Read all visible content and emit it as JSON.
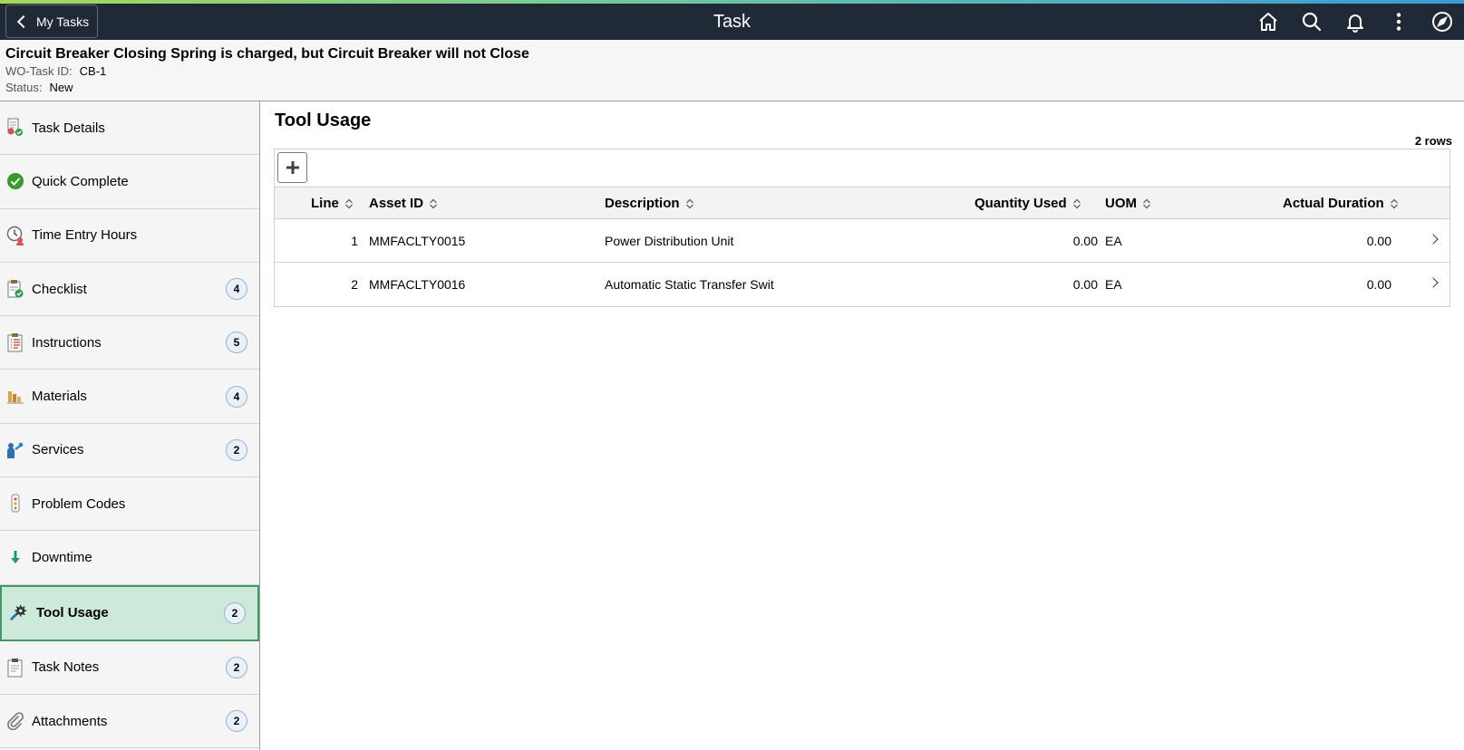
{
  "header": {
    "back_label": "My Tasks",
    "title": "Task",
    "icons": [
      "home-icon",
      "search-icon",
      "bell-icon",
      "more-vertical-icon",
      "compass-icon"
    ]
  },
  "task": {
    "title": "Circuit Breaker Closing Spring is charged, but Circuit Breaker will not Close",
    "id_label": "WO-Task ID:",
    "id_value": "CB-1",
    "status_label": "Status:",
    "status_value": "New"
  },
  "sidebar": {
    "items": [
      {
        "label": "Task Details",
        "icon": "task-details-icon",
        "badge": ""
      },
      {
        "label": "Quick Complete",
        "icon": "check-circle-icon",
        "badge": ""
      },
      {
        "label": "Time Entry Hours",
        "icon": "clock-person-icon",
        "badge": ""
      },
      {
        "label": "Checklist",
        "icon": "checklist-icon",
        "badge": "4"
      },
      {
        "label": "Instructions",
        "icon": "instructions-icon",
        "badge": "5"
      },
      {
        "label": "Materials",
        "icon": "materials-icon",
        "badge": "4"
      },
      {
        "label": "Services",
        "icon": "services-icon",
        "badge": "2"
      },
      {
        "label": "Problem Codes",
        "icon": "problem-codes-icon",
        "badge": ""
      },
      {
        "label": "Downtime",
        "icon": "down-arrow-icon",
        "badge": ""
      },
      {
        "label": "Tool Usage",
        "icon": "tools-icon",
        "badge": "2"
      },
      {
        "label": "Task Notes",
        "icon": "notes-icon",
        "badge": "2"
      },
      {
        "label": "Attachments",
        "icon": "paperclip-icon",
        "badge": "2"
      }
    ],
    "active": "Tool Usage"
  },
  "main": {
    "title": "Tool Usage",
    "row_count": "2 rows",
    "columns": [
      "Line",
      "Asset ID",
      "Description",
      "Quantity Used",
      "UOM",
      "Actual Duration"
    ],
    "rows": [
      {
        "line": "1",
        "asset_id": "MMFACLTY0015",
        "description": "Power Distribution Unit",
        "quantity": "0.00",
        "uom": "EA",
        "duration": "0.00"
      },
      {
        "line": "2",
        "asset_id": "MMFACLTY0016",
        "description": "Automatic Static Transfer Swit",
        "quantity": "0.00",
        "uom": "EA",
        "duration": "0.00"
      }
    ]
  },
  "colors": {
    "header_bg": "#1f2a36",
    "active_bg": "#cde9d9",
    "active_border": "#3e9a61",
    "badge_bg": "#e8f1f9"
  }
}
